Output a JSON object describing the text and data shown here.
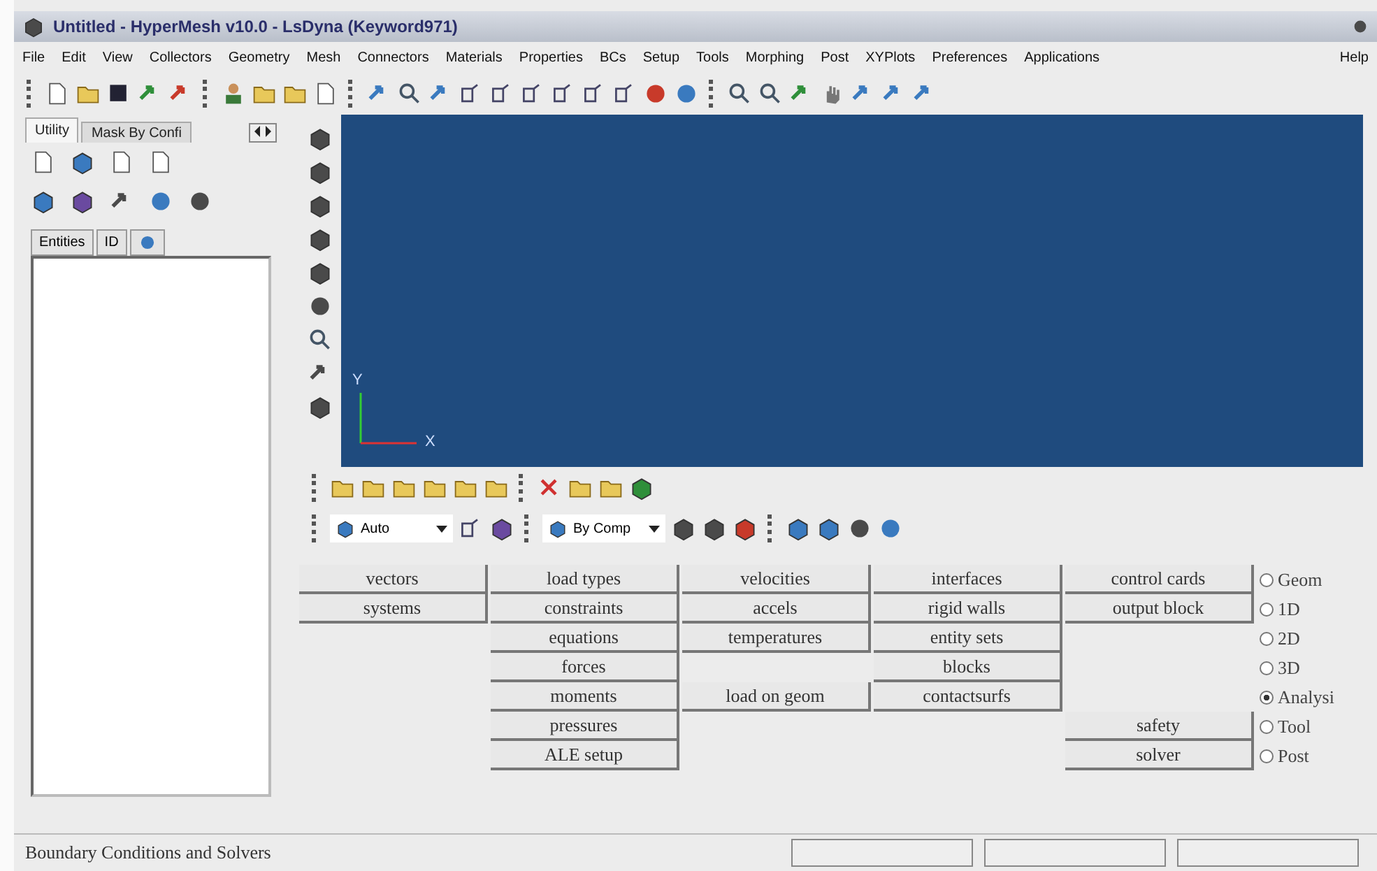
{
  "window": {
    "title": "Untitled - HyperMesh v10.0 - LsDyna (Keyword971)"
  },
  "menu": [
    "File",
    "Edit",
    "View",
    "Collectors",
    "Geometry",
    "Mesh",
    "Connectors",
    "Materials",
    "Properties",
    "BCs",
    "Setup",
    "Tools",
    "Morphing",
    "Post",
    "XYPlots",
    "Preferences",
    "Applications",
    "Help"
  ],
  "browser": {
    "tabs": [
      {
        "label": "Utility",
        "selected": true
      },
      {
        "label": "Mask By Confi",
        "selected": false
      }
    ],
    "columns": [
      "Entities",
      "ID"
    ]
  },
  "viewport": {
    "axis_labels": [
      "Y",
      "X"
    ]
  },
  "display_toolbar": {
    "dropdowns": [
      {
        "value": "Auto"
      },
      {
        "value": "By Comp"
      }
    ]
  },
  "panel": {
    "columns": [
      [
        "vectors",
        "systems"
      ],
      [
        "load types",
        "constraints",
        "equations",
        "forces",
        "moments",
        "pressures",
        "ALE setup"
      ],
      [
        "velocities",
        "accels",
        "temperatures",
        null,
        "load on geom"
      ],
      [
        "interfaces",
        "rigid walls",
        "entity sets",
        "blocks",
        "contactsurfs"
      ],
      [
        "control cards",
        "output block",
        null,
        null,
        null,
        "safety",
        "solver"
      ]
    ],
    "pages": [
      {
        "label": "Geom",
        "selected": false
      },
      {
        "label": "1D",
        "selected": false
      },
      {
        "label": "2D",
        "selected": false
      },
      {
        "label": "3D",
        "selected": false
      },
      {
        "label": "Analysi",
        "selected": true
      },
      {
        "label": "Tool",
        "selected": false
      },
      {
        "label": "Post",
        "selected": false
      }
    ]
  },
  "status_bar": {
    "text": "Boundary Conditions and Solvers"
  }
}
